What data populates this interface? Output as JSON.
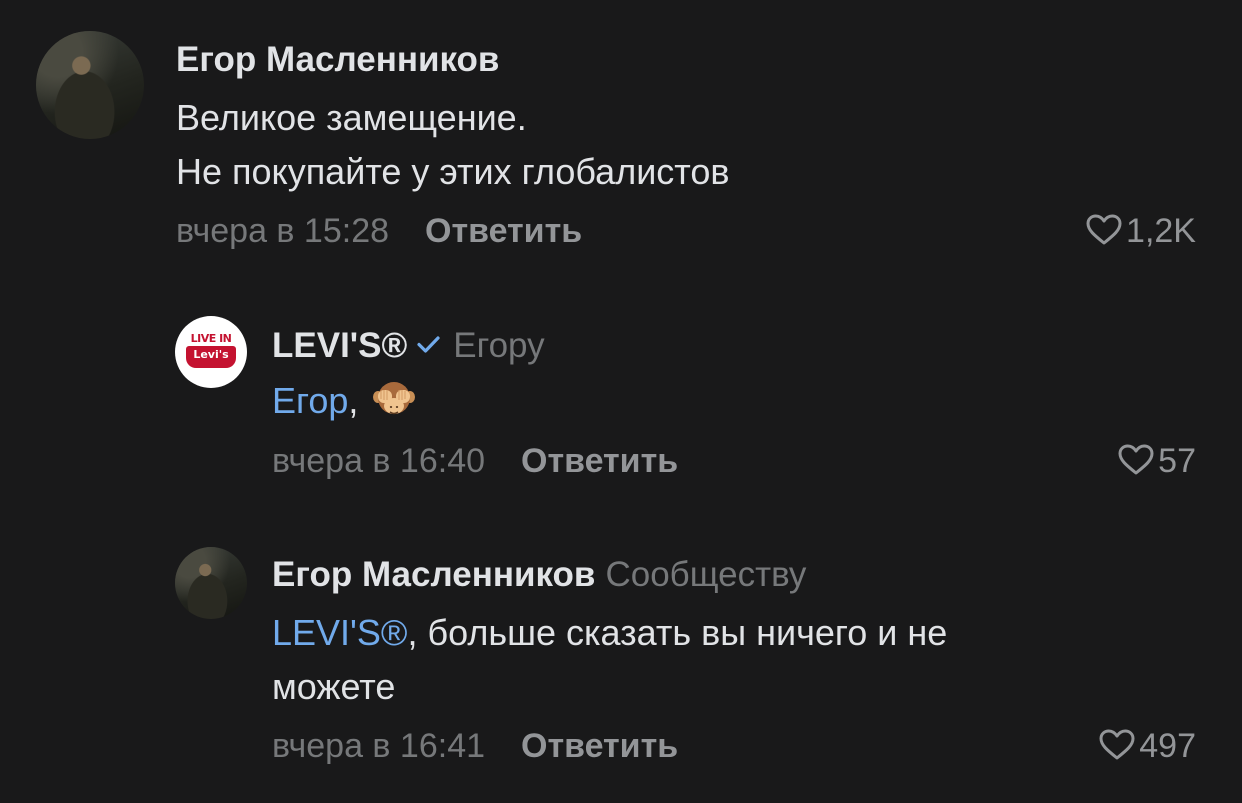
{
  "comments": [
    {
      "author": "Егор Масленников",
      "reply_to": "",
      "text_lines": [
        "Великое замещение.",
        "Не покупайте у этих глобалистов"
      ],
      "time": "вчера в 15:28",
      "reply_label": "Ответить",
      "likes": "1,2K",
      "avatar_icon": "user-photo"
    },
    {
      "author": "LEVI'S®",
      "verified_icon": "checkmark-icon",
      "reply_to": "Егору",
      "mention": "Егор",
      "text_after_mention": ",",
      "emoji": "see-no-evil-monkey",
      "time": "вчера в 16:40",
      "reply_label": "Ответить",
      "likes": "57",
      "avatar_logo_text_top": "LIVE IN",
      "avatar_logo_text_bottom": "Levi's"
    },
    {
      "author": "Егор Масленников",
      "reply_to": "Сообществу",
      "mention": "LEVI'S®",
      "text_after_mention": ", больше сказать вы ничего и не",
      "text_line2": "можете",
      "time": "вчера в 16:41",
      "reply_label": "Ответить",
      "likes": "497",
      "avatar_icon": "user-photo"
    }
  ],
  "colors": {
    "background": "#19191a",
    "text": "#e1e3e6",
    "secondary": "#76787a",
    "accent": "#71aaeb",
    "levis_red": "#c41230"
  }
}
